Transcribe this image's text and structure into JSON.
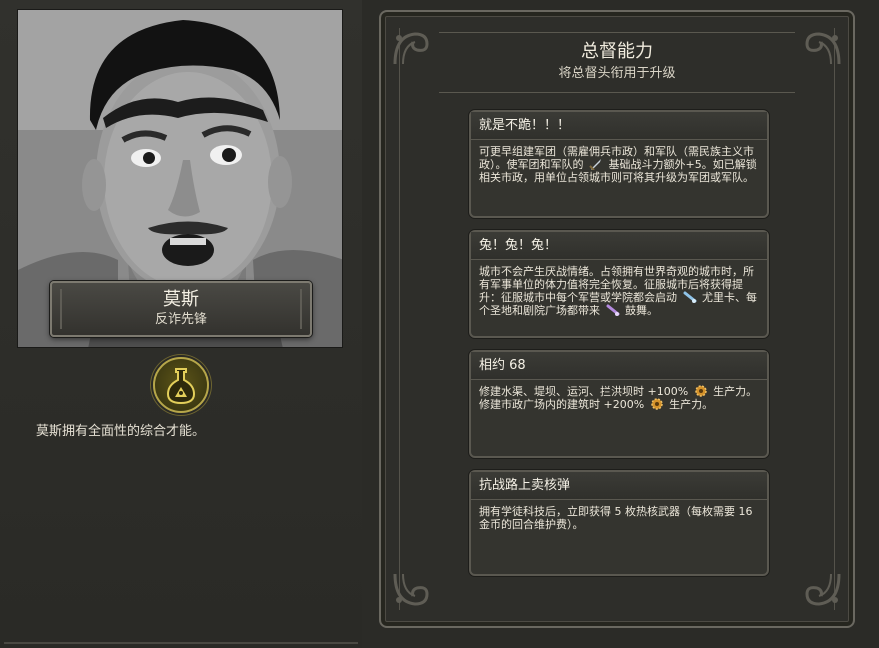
{
  "leader": {
    "name": "莫斯",
    "title": "反诈先锋",
    "description": "莫斯拥有全面性的综合才能。",
    "badge_icon": "governor-flask-icon",
    "portrait": "leader-portrait"
  },
  "panel": {
    "title": "总督能力",
    "subtitle": "将总督头衔用于升级"
  },
  "abilities": [
    {
      "name": "就是不跪！！！",
      "desc_1": "可更早组建军团（需雇佣兵市政）和军队（需民族主义市政）。使军团和军队的",
      "icon_1": "combat-strength-icon",
      "desc_2": "基础战斗力额外+5。如已解锁相关市政，用单位占领城市则可将其升级为军团或军队。"
    },
    {
      "name": "兔！兔！兔！",
      "desc_1": "城市不会产生厌战情绪。占领拥有世界奇观的城市时，所有军事单位的体力值将完全恢复。征服城市后将获得提升：征服城市中每个军营或学院都会启动",
      "icon_1": "science-icon",
      "desc_2": "尤里卡、每个圣地和剧院广场都带来",
      "icon_2": "culture-icon",
      "desc_3": "鼓舞。"
    },
    {
      "name": "相约 68",
      "desc_1": "修建水渠、堤坝、运河、拦洪坝时 +100%",
      "icon_1": "production-icon",
      "desc_2": "生产力。修建市政广场内的建筑时 +200%",
      "icon_2": "production-icon",
      "desc_3": "生产力。"
    },
    {
      "name": "抗战路上卖核弹",
      "desc_1": "拥有学徒科技后，立即获得 5 枚热核武器（每枚需要 16 金币的回合维护费）。"
    }
  ],
  "colors": {
    "background": "#2b2b27",
    "frame": "#6a6860",
    "badge_gold": "#b6a64a",
    "production": "#d4922a",
    "science": "#8fc3e8",
    "culture": "#b58be0"
  }
}
